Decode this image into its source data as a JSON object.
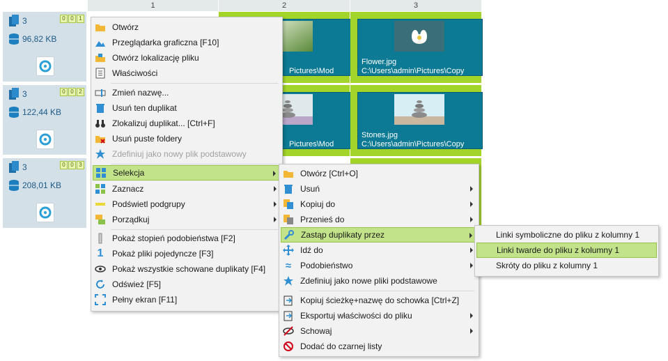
{
  "columns": [
    "1",
    "2",
    "3"
  ],
  "groups": [
    {
      "count": "3",
      "size": "96,82 KB",
      "badge": [
        "0",
        "0",
        "1"
      ]
    },
    {
      "count": "3",
      "size": "122,44 KB",
      "badge": [
        "0",
        "0",
        "2"
      ]
    },
    {
      "count": "3",
      "size": "208,01 KB",
      "badge": [
        "0",
        "0",
        "3"
      ]
    }
  ],
  "tiles": [
    {
      "name": "",
      "path": "Pictures\\Mod"
    },
    {
      "name": "Flower.jpg",
      "path": "C:\\Users\\admin\\Pictures\\Copy"
    },
    {
      "name": "",
      "path": "Pictures\\Mod"
    },
    {
      "name": "Stones.jpg",
      "path": "C:\\Users\\admin\\Pictures\\Copy"
    }
  ],
  "menu1": [
    {
      "label": "Otwórz",
      "icon": "folder-icon"
    },
    {
      "label": "Przeglądarka graficzna  [F10]",
      "icon": "image-viewer-icon"
    },
    {
      "label": "Otwórz lokalizację pliku",
      "icon": "folder-location-icon"
    },
    {
      "label": "Właściwości",
      "icon": "properties-icon"
    },
    {
      "label": "Zmień nazwę...",
      "icon": "rename-icon"
    },
    {
      "label": "Usuń ten duplikat",
      "icon": "trash-icon"
    },
    {
      "label": "Zlokalizuj duplikat...  [Ctrl+F]",
      "icon": "binoculars-icon"
    },
    {
      "label": "Usuń puste foldery",
      "icon": "folder-delete-icon"
    },
    {
      "label": "Zdefiniuj jako nowy plik podstawowy",
      "icon": "star-icon"
    },
    {
      "label": "Selekcja",
      "icon": "selection-icon"
    },
    {
      "label": "Zaznacz",
      "icon": "mark-icon"
    },
    {
      "label": "Podświetl podgrupy",
      "icon": "highlight-icon"
    },
    {
      "label": "Porządkuj",
      "icon": "sort-icon"
    },
    {
      "label": "Pokaż stopień podobieństwa  [F2]",
      "icon": "similarity-bar-icon"
    },
    {
      "label": "Pokaż pliki pojedyncze  [F3]",
      "icon": "single-icon"
    },
    {
      "label": "Pokaż wszystkie schowane duplikaty  [F4]",
      "icon": "eye-icon"
    },
    {
      "label": "Odśwież  [F5]",
      "icon": "refresh-icon"
    },
    {
      "label": "Pełny ekran  [F11]",
      "icon": "fullscreen-icon"
    }
  ],
  "menu2": [
    {
      "label": "Otwórz  [Ctrl+O]",
      "icon": "folder-icon"
    },
    {
      "label": "Usuń",
      "icon": "trash-icon"
    },
    {
      "label": "Kopiuj do",
      "icon": "copy-icon"
    },
    {
      "label": "Przenieś do",
      "icon": "move-icon"
    },
    {
      "label": "Zastąp duplikaty przez",
      "icon": "wrench-icon"
    },
    {
      "label": "Idź do",
      "icon": "goto-icon"
    },
    {
      "label": "Podobieństwo",
      "icon": "approx-icon"
    },
    {
      "label": "Zdefiniuj jako nowe pliki podstawowe",
      "icon": "star-icon"
    },
    {
      "label": "Kopiuj ścieżkę+nazwę do schowka  [Ctrl+Z]",
      "icon": "clipboard-icon"
    },
    {
      "label": "Eksportuj właściwości do pliku",
      "icon": "export-icon"
    },
    {
      "label": "Schowaj",
      "icon": "hide-icon"
    },
    {
      "label": "Dodać do czarnej listy",
      "icon": "blacklist-icon"
    }
  ],
  "menu3": [
    {
      "label": "Linki symboliczne do pliku z kolumny 1"
    },
    {
      "label": "Linki twarde do pliku z kolumny 1"
    },
    {
      "label": "Skróty do pliku z kolumny 1"
    }
  ],
  "colors": {
    "accent": "#a3d42a",
    "tile": "#0c7a94",
    "highlight": "#c3e38a",
    "left": "#d3e0e8"
  }
}
